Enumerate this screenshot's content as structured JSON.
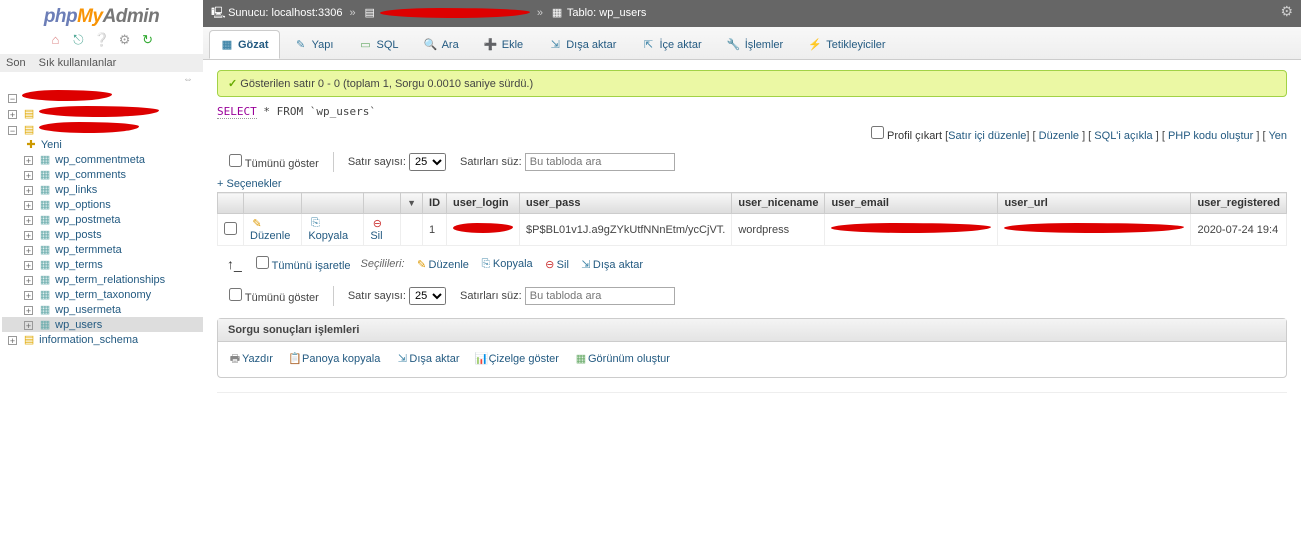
{
  "logo": {
    "p1": "php",
    "p2": "My",
    "p3": "Admin"
  },
  "quick": {
    "recent": "Son",
    "fav": "Sık kullanılanlar"
  },
  "tree": {
    "new": "Yeni",
    "items": [
      {
        "label": "wp_commentmeta"
      },
      {
        "label": "wp_comments"
      },
      {
        "label": "wp_links"
      },
      {
        "label": "wp_options"
      },
      {
        "label": "wp_postmeta"
      },
      {
        "label": "wp_posts"
      },
      {
        "label": "wp_termmeta"
      },
      {
        "label": "wp_terms"
      },
      {
        "label": "wp_term_relationships"
      },
      {
        "label": "wp_term_taxonomy"
      },
      {
        "label": "wp_usermeta"
      },
      {
        "label": "wp_users"
      }
    ],
    "infoschema": "information_schema"
  },
  "breadcrumb": {
    "server_label": "Sunucu:",
    "server": "localhost:3306",
    "table_label": "Tablo:",
    "table": "wp_users"
  },
  "tabs": {
    "browse": "Gözat",
    "structure": "Yapı",
    "sql": "SQL",
    "search": "Ara",
    "insert": "Ekle",
    "export": "Dışa aktar",
    "import": "İçe aktar",
    "ops": "İşlemler",
    "triggers": "Tetikleyiciler"
  },
  "msg_ok": "Gösterilen satır 0 - 0 (toplam 1, Sorgu 0.0010 saniye sürdü.)",
  "sql_kw": "SELECT",
  "sql_rest": " * FROM `wp_users`",
  "profile": {
    "label": "Profil çıkart",
    "inline": "Satır içi düzenle",
    "edit": "Düzenle",
    "explain": "SQL'i açıkla",
    "php": "PHP kodu oluştur",
    "refresh": "Yen"
  },
  "filters": {
    "showall": "Tümünü göster",
    "rows_label": "Satır sayısı:",
    "rows_value": "25",
    "filter_label": "Satırları süz:",
    "placeholder": "Bu tabloda ara"
  },
  "opts": "+ Seçenekler",
  "table": {
    "cols": [
      "ID",
      "user_login",
      "user_pass",
      "user_nicename",
      "user_email",
      "user_url",
      "user_registered"
    ],
    "row": {
      "edit": "Düzenle",
      "copy": "Kopyala",
      "delete": "Sil",
      "id": "1",
      "pass": "$P$BL01v1J.a9gZYkUtfNNnEtm/ycCjVT.",
      "nicename": "wordpress",
      "registered": "2020-07-24 19:4"
    }
  },
  "bulk": {
    "checkall": "Tümünü işaretle",
    "selected": "Seçilileri:",
    "edit": "Düzenle",
    "copy": "Kopyala",
    "delete": "Sil",
    "export": "Dışa aktar"
  },
  "ops_box": {
    "title": "Sorgu sonuçları işlemleri",
    "print": "Yazdır",
    "clipboard": "Panoya kopyala",
    "export": "Dışa aktar",
    "chart": "Çizelge göster",
    "view": "Görünüm oluştur"
  }
}
